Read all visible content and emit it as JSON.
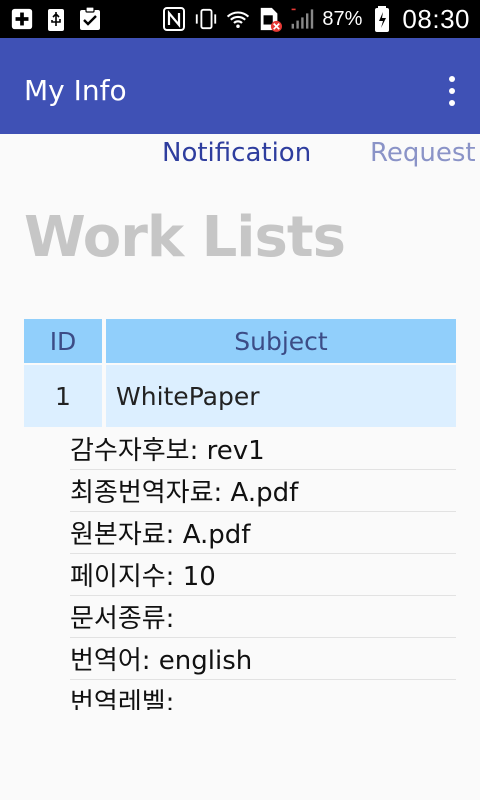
{
  "status_bar": {
    "battery": "87%",
    "time": "08:30"
  },
  "app_bar": {
    "title": "My Info"
  },
  "tabs": [
    {
      "label": "Notification"
    },
    {
      "label": "Request"
    }
  ],
  "heading": "Work Lists",
  "table": {
    "headers": [
      "ID",
      "Subject"
    ],
    "rows": [
      {
        "id": "1",
        "subject": "WhitePaper"
      }
    ]
  },
  "details": [
    "감수자후보:  rev1",
    "최종번역자료: A.pdf",
    "원본자료: A.pdf",
    "페이지수: 10",
    "문서종류:",
    "번역어: english",
    "번역레벨:"
  ],
  "colors": {
    "app_bar": "#3f51b5",
    "tab_active": "#2e3d9e",
    "tab_inactive": "#8a93c7",
    "table_header": "#91cffb",
    "table_row": "#dcefff"
  }
}
